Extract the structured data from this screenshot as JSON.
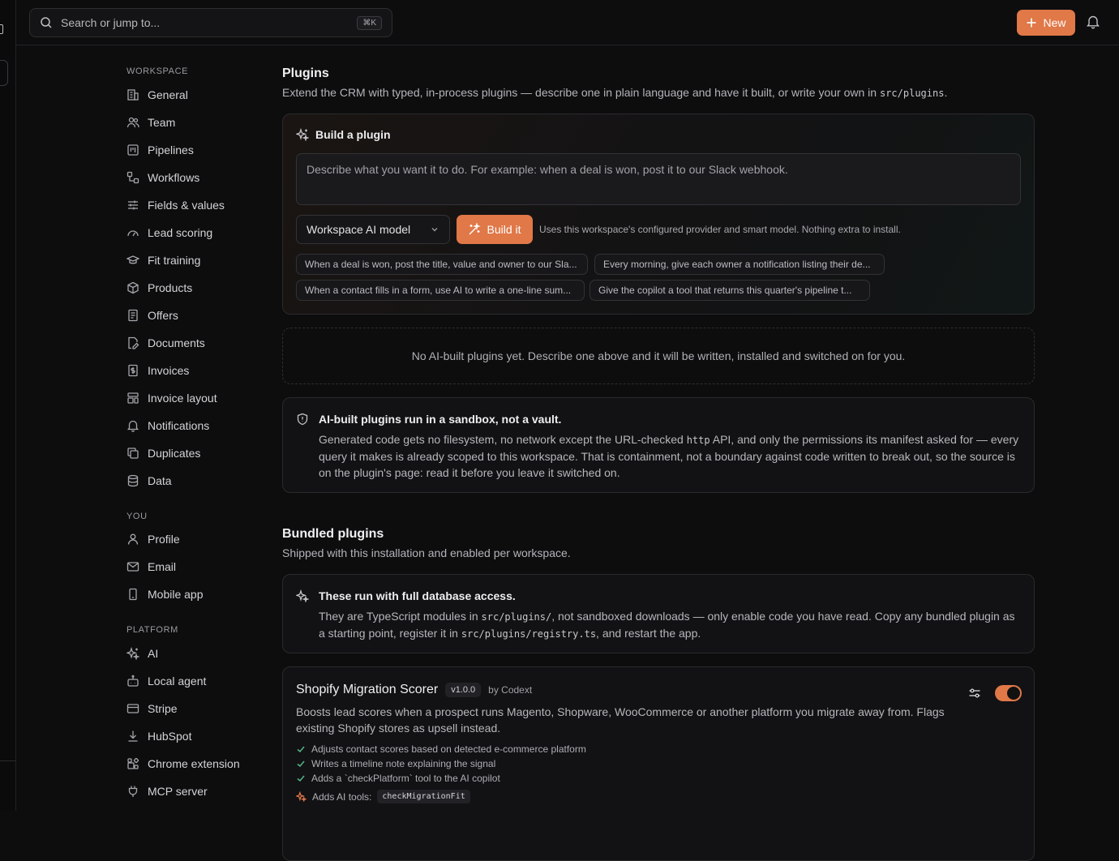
{
  "topbar": {
    "search_placeholder": "Search or jump to...",
    "search_shortcut": "⌘K",
    "new_label": "New"
  },
  "sidebar": {
    "workspace_heading": "WORKSPACE",
    "workspace_items": [
      {
        "label": "General",
        "icon": "building-icon"
      },
      {
        "label": "Team",
        "icon": "users-icon"
      },
      {
        "label": "Pipelines",
        "icon": "kanban-icon"
      },
      {
        "label": "Workflows",
        "icon": "workflow-icon"
      },
      {
        "label": "Fields & values",
        "icon": "sliders-icon"
      },
      {
        "label": "Lead scoring",
        "icon": "gauge-icon"
      },
      {
        "label": "Fit training",
        "icon": "graduation-cap-icon"
      },
      {
        "label": "Products",
        "icon": "box-icon"
      },
      {
        "label": "Offers",
        "icon": "file-text-icon"
      },
      {
        "label": "Documents",
        "icon": "file-edit-icon"
      },
      {
        "label": "Invoices",
        "icon": "receipt-icon"
      },
      {
        "label": "Invoice layout",
        "icon": "layout-icon"
      },
      {
        "label": "Notifications",
        "icon": "bell-icon"
      },
      {
        "label": "Duplicates",
        "icon": "copy-icon"
      },
      {
        "label": "Data",
        "icon": "database-icon"
      }
    ],
    "you_heading": "YOU",
    "you_items": [
      {
        "label": "Profile",
        "icon": "user-icon"
      },
      {
        "label": "Email",
        "icon": "mail-icon"
      },
      {
        "label": "Mobile app",
        "icon": "smartphone-icon"
      }
    ],
    "platform_heading": "PLATFORM",
    "platform_items": [
      {
        "label": "AI",
        "icon": "sparkles-icon"
      },
      {
        "label": "Local agent",
        "icon": "bot-icon"
      },
      {
        "label": "Stripe",
        "icon": "credit-card-icon"
      },
      {
        "label": "HubSpot",
        "icon": "download-icon"
      },
      {
        "label": "Chrome extension",
        "icon": "puzzle-icon"
      },
      {
        "label": "MCP server",
        "icon": "plug-icon"
      }
    ]
  },
  "plugins": {
    "title": "Plugins",
    "subtitle": "Extend the CRM with typed, in-process plugins — describe one in plain language and have it built, or write your own in",
    "subtitle_code": "src/plugins",
    "subtitle_end": ".",
    "build": {
      "title": "Build a plugin",
      "placeholder": "Describe what you want it to do. For example: when a deal is won, post it to our Slack webhook.",
      "model_label": "Workspace AI model",
      "build_label": "Build it",
      "hint": "Uses this workspace's configured provider and smart model. Nothing extra to install.",
      "suggestions": [
        "When a deal is won, post the title, value and owner to our Sla...",
        "Every morning, give each owner a notification listing their de...",
        "When a contact fills in a form, use AI to write a one-line sum...",
        "Give the copilot a tool that returns this quarter's pipeline t..."
      ]
    },
    "empty": "No AI-built plugins yet. Describe one above and it will be written, installed and switched on for you.",
    "sandbox": {
      "title": "AI-built plugins run in a sandbox, not a vault.",
      "body_a": "Generated code gets no filesystem, no network except the URL-checked",
      "body_code": "http",
      "body_b": "API, and only the permissions its manifest asked for — every query it makes is already scoped to this workspace. That is containment, not a boundary against code written to break out, so the source is on the plugin's page: read it before you leave it switched on."
    }
  },
  "bundled": {
    "title": "Bundled plugins",
    "subtitle": "Shipped with this installation and enabled per workspace.",
    "notice": {
      "title": "These run with full database access.",
      "body_a": "They are TypeScript modules in",
      "code_a": "src/plugins/",
      "body_b": ", not sandboxed downloads — only enable code you have read. Copy any bundled plugin as a starting point, register it in",
      "code_b": "src/plugins/registry.ts",
      "body_c": ", and restart the app."
    },
    "plugin": {
      "name": "Shopify Migration Scorer",
      "version": "v1.0.0",
      "author": "by Codext",
      "description": "Boosts lead scores when a prospect runs Magento, Shopware, WooCommerce or another platform you migrate away from. Flags existing Shopify stores as upsell instead.",
      "features": [
        "Adjusts contact scores based on detected e-commerce platform",
        "Writes a timeline note explaining the signal",
        "Adds a `checkPlatform` tool to the AI copilot"
      ],
      "tools_label": "Adds AI tools:",
      "tool": "checkMigrationFit",
      "enabled": true
    }
  },
  "colors": {
    "accent": "#e07848",
    "background": "#0d0d0e"
  }
}
